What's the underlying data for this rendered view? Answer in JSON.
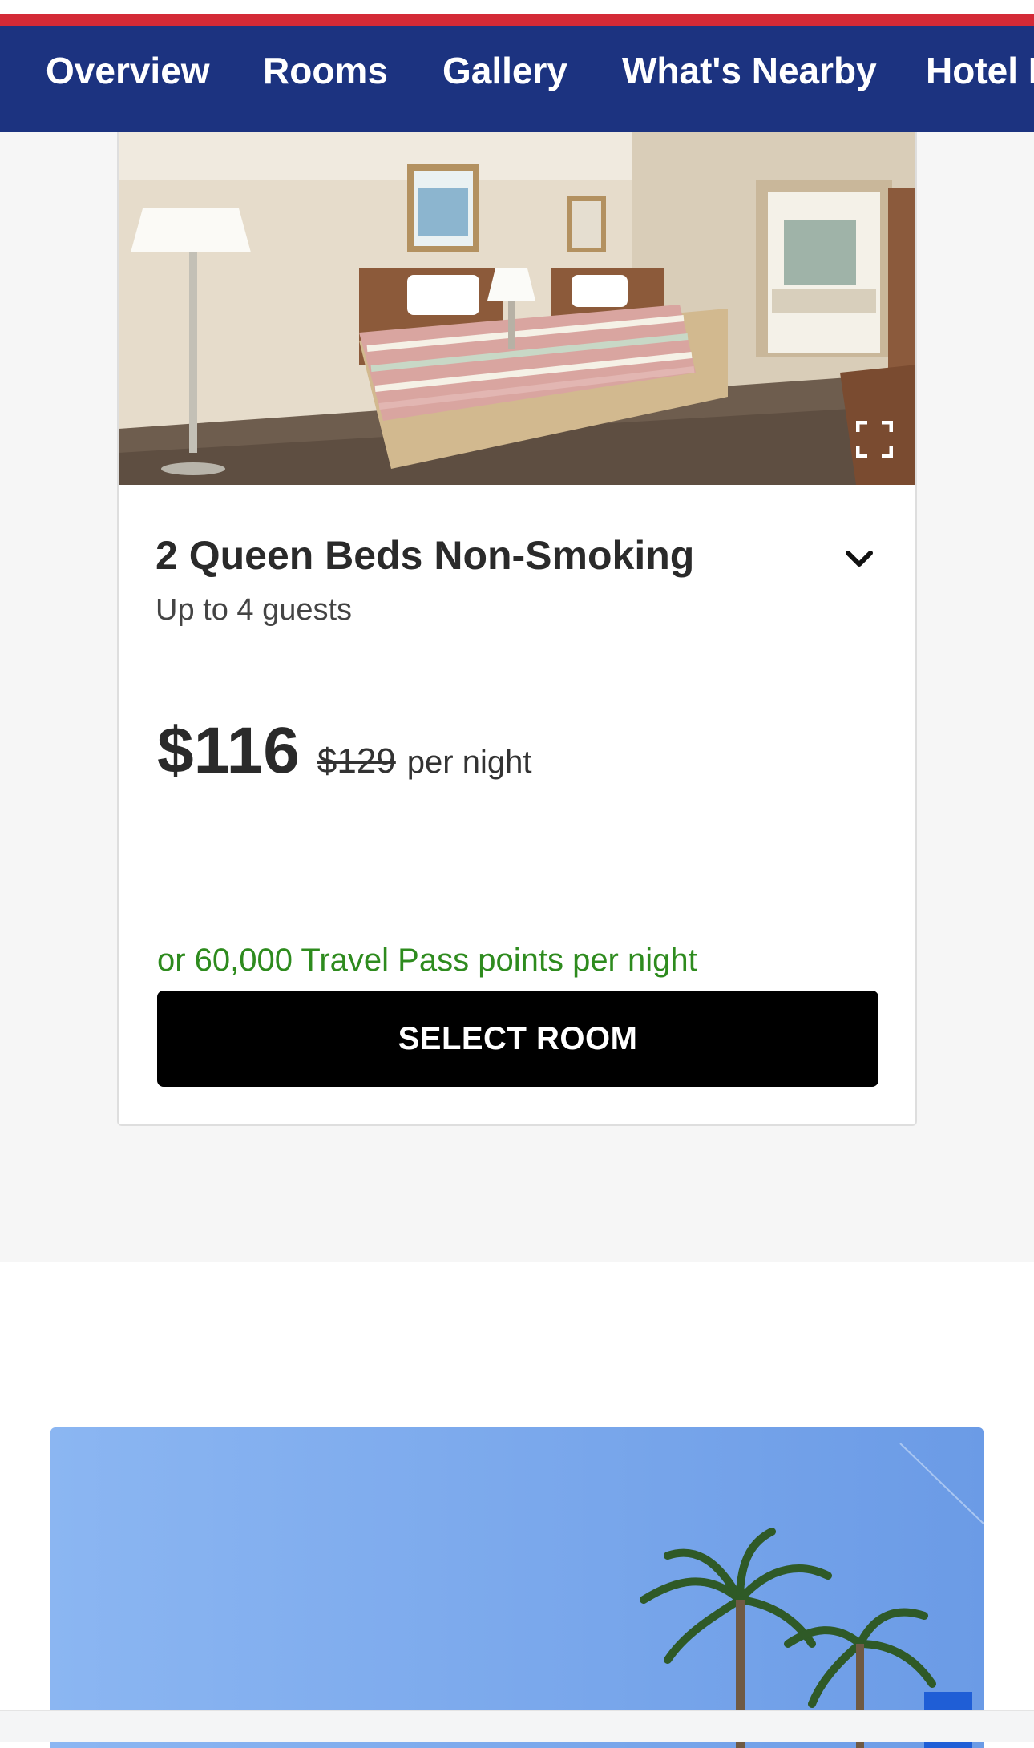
{
  "nav": {
    "tabs": [
      {
        "label": "Overview"
      },
      {
        "label": "Rooms"
      },
      {
        "label": "Gallery"
      },
      {
        "label": "What's Nearby"
      },
      {
        "label": "Hotel I"
      }
    ]
  },
  "room": {
    "title": "2 Queen Beds Non-Smoking",
    "guests": "Up to 4 guests",
    "price": "$116",
    "original_price": "$129",
    "price_unit": "per night",
    "points": "or 60,000 Travel Pass points per night",
    "select_label": "SELECT ROOM"
  },
  "colors": {
    "nav_background": "#1c3380",
    "top_accent": "#d42a37",
    "points_text": "#2e8b1e",
    "button_background": "#000000"
  },
  "icons": {
    "expand": "fullscreen-corners-icon",
    "chevron": "chevron-down-icon"
  }
}
